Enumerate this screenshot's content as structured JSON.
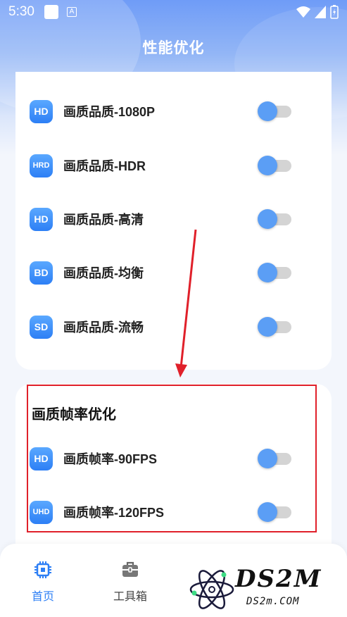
{
  "status_bar": {
    "time": "5:30",
    "a_icon": "A"
  },
  "header": {
    "title": "性能优化"
  },
  "quality_list": [
    {
      "badge": "HD",
      "label": "画质品质-1080P",
      "enabled": false
    },
    {
      "badge": "HRD",
      "label": "画质品质-HDR",
      "enabled": false
    },
    {
      "badge": "HD",
      "label": "画质品质-高清",
      "enabled": false
    },
    {
      "badge": "BD",
      "label": "画质品质-均衡",
      "enabled": false
    },
    {
      "badge": "SD",
      "label": "画质品质-流畅",
      "enabled": false
    }
  ],
  "framerate": {
    "title": "画质帧率优化",
    "items": [
      {
        "badge": "HD",
        "label": "画质帧率-90FPS",
        "enabled": false
      },
      {
        "badge": "UHD",
        "label": "画质帧率-120FPS",
        "enabled": false
      }
    ]
  },
  "bottom_nav": [
    {
      "label": "首页",
      "icon": "chip-icon",
      "active": true
    },
    {
      "label": "工具箱",
      "icon": "toolbox-icon",
      "active": false
    }
  ],
  "watermark": {
    "text": "DS2M",
    "sub": "DS2m.COM"
  },
  "colors": {
    "accent": "#2d7ff5",
    "toggle_knob": "#5b9ef5",
    "highlight": "#e0202a"
  }
}
